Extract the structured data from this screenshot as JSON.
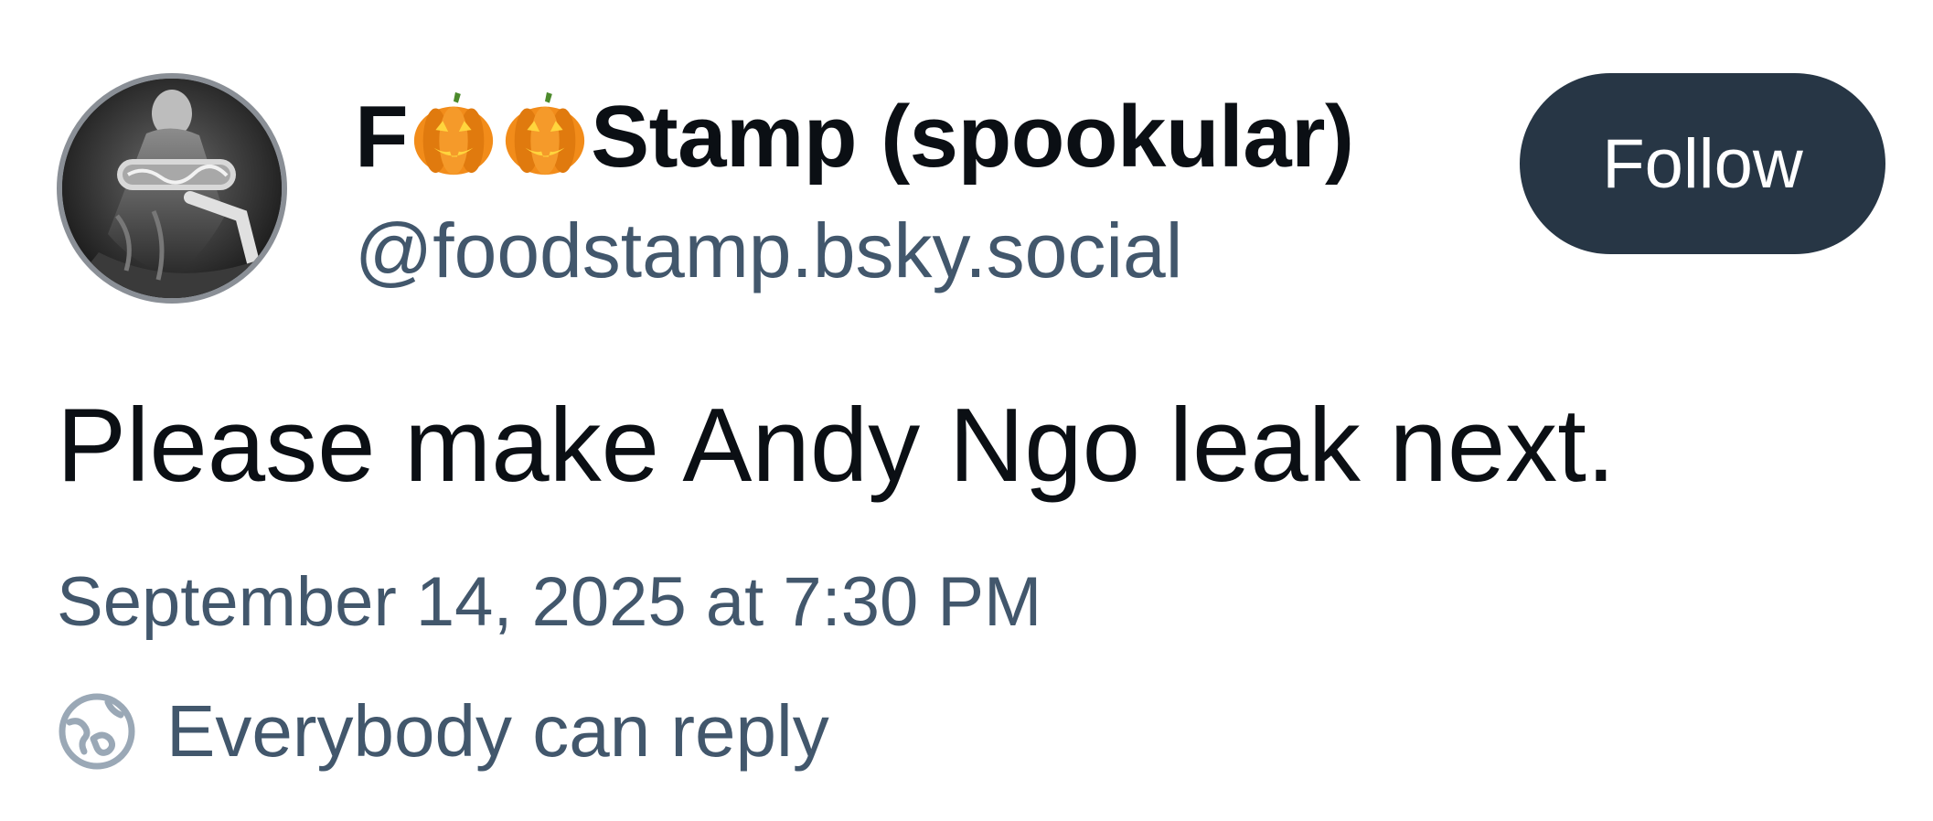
{
  "author": {
    "name_prefix": "F",
    "name_suffix": "Stamp (spookular)",
    "name_emojis": [
      "pumpkin-icon",
      "pumpkin-icon"
    ],
    "handle": "@foodstamp.bsky.social"
  },
  "follow_label": "Follow",
  "post": {
    "text": "Please make Andy Ngo leak next.",
    "timestamp": "September 14, 2025 at 7:30 PM"
  },
  "reply_setting": {
    "icon": "globe-icon",
    "label": "Everybody can reply"
  },
  "colors": {
    "text": "#0b0f14",
    "muted": "#42576c",
    "button_bg": "#273645",
    "button_text": "#ffffff",
    "pumpkin": "#f28c1a"
  }
}
